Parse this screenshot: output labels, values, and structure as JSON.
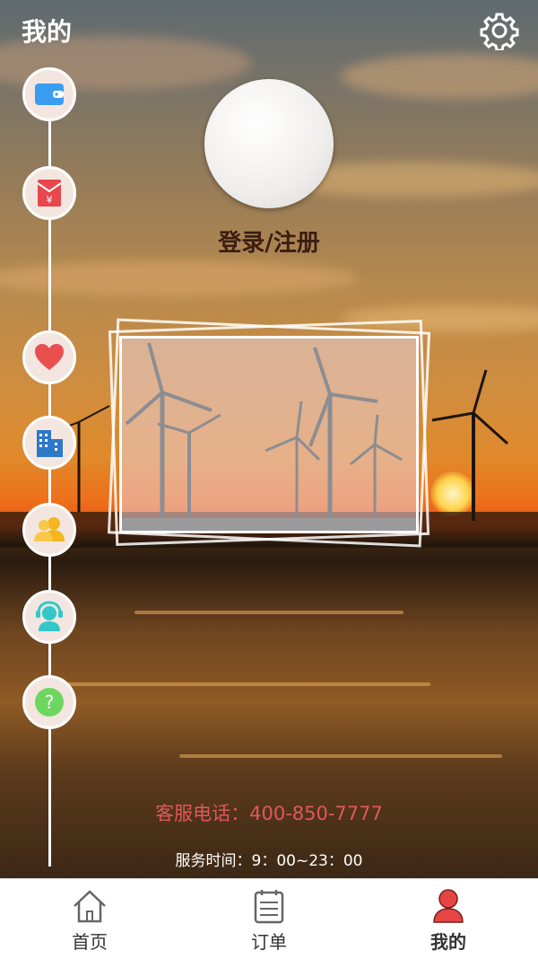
{
  "header": {
    "title": "我的",
    "settings_icon": "gear-icon"
  },
  "profile": {
    "login_label": "登录/注册"
  },
  "sidebar": {
    "items": [
      {
        "icon": "wallet-icon",
        "color": "#3a9df2"
      },
      {
        "icon": "red-envelope-icon",
        "color": "#e8474b"
      },
      {
        "icon": "heart-icon",
        "color": "#ea4f4f"
      },
      {
        "icon": "building-icon",
        "color": "#2d78c8"
      },
      {
        "icon": "contacts-icon",
        "color": "#f3b61f"
      },
      {
        "icon": "customer-service-icon",
        "color": "#32c8c8"
      },
      {
        "icon": "help-icon",
        "color": "#6dd65f"
      }
    ]
  },
  "contact": {
    "phone_text": "客服电话：400-850-7777",
    "hours_text": "服务时间：9：00~23：00"
  },
  "tabbar": {
    "tabs": [
      {
        "label": "首页",
        "icon": "home-icon",
        "active": false
      },
      {
        "label": "订单",
        "icon": "orders-icon",
        "active": false
      },
      {
        "label": "我的",
        "icon": "person-icon",
        "active": true
      }
    ],
    "active_color": "#e64545"
  }
}
